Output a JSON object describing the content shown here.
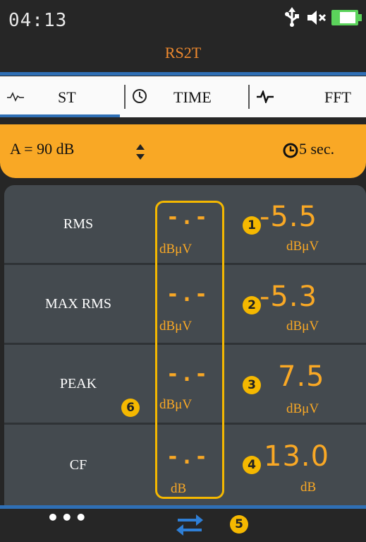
{
  "status": {
    "time": "04:13"
  },
  "app": {
    "title": "RS2T"
  },
  "colors": {
    "accent": "#f9a825",
    "blue": "#2f6fb5",
    "title": "#f08a2e",
    "panel": "#444a4f"
  },
  "tabs": [
    {
      "label": "ST",
      "icon": "waveform-icon",
      "active": true
    },
    {
      "label": "TIME",
      "icon": "clock-icon",
      "active": false
    },
    {
      "label": "FFT",
      "icon": "pulse-icon",
      "active": false
    }
  ],
  "settings": {
    "weighting": "A = 90 dB",
    "interval": "5 sec."
  },
  "measurements": [
    {
      "label": "RMS",
      "left_value": "-.-",
      "left_unit": "dBμV",
      "badge": "1",
      "value": "-5.5",
      "unit": "dBμV"
    },
    {
      "label": "MAX RMS",
      "left_value": "-.-",
      "left_unit": "dBμV",
      "badge": "2",
      "value": "-5.3",
      "unit": "dBμV"
    },
    {
      "label": "PEAK",
      "left_value": "-.-",
      "left_unit": "dBμV",
      "badge": "3",
      "value": "7.5",
      "unit": "dBμV"
    },
    {
      "label": "CF",
      "left_value": "-.-",
      "left_unit": "dB",
      "badge": "4",
      "value": "13.0",
      "unit": "dB"
    }
  ],
  "annotations": {
    "swap_badge": "5",
    "column_badge": "6"
  },
  "bottom": {
    "more": "•••"
  }
}
